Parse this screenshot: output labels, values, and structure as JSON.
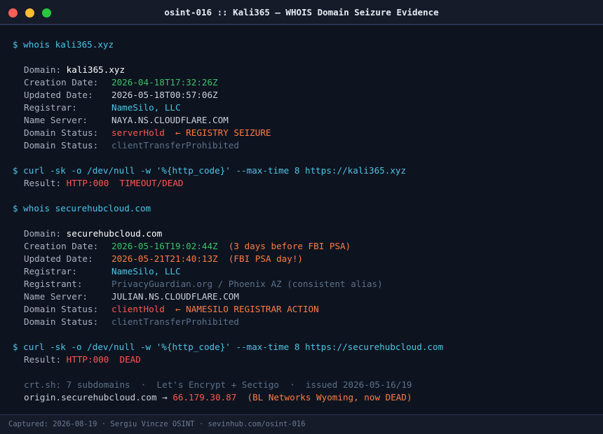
{
  "window": {
    "title": "osint-016 :: Kali365 — WHOIS Domain Seizure Evidence"
  },
  "block1": {
    "cmd": "$ whois kali365.xyz",
    "domain_label": "Domain:",
    "domain_value": "kali365.xyz",
    "creation_label": "Creation Date:",
    "creation_value": "2026-04-18T17:32:26Z",
    "updated_label": "Updated Date:",
    "updated_value": "2026-05-18T00:57:06Z",
    "registrar_label": "Registrar:",
    "registrar_value": "NameSilo, LLC",
    "ns_label": "Name Server:",
    "ns_value": "NAYA.NS.CLOUDFLARE.COM",
    "status1_label": "Domain Status:",
    "status1_value": "serverHold",
    "status1_note": "← REGISTRY SEIZURE",
    "status2_label": "Domain Status:",
    "status2_value": "clientTransferProhibited"
  },
  "block2": {
    "cmd": "$ curl -sk -o /dev/null -w '%{http_code}' --max-time 8 https://kali365.xyz",
    "result_label": "Result:",
    "result_code": "HTTP:000",
    "result_note": "TIMEOUT/DEAD"
  },
  "block3": {
    "cmd": "$ whois securehubcloud.com",
    "domain_label": "Domain:",
    "domain_value": "securehubcloud.com",
    "creation_label": "Creation Date:",
    "creation_value": "2026-05-16T19:02:44Z",
    "creation_note": "(3 days before FBI PSA)",
    "updated_label": "Updated Date:",
    "updated_value": "2026-05-21T21:40:13Z",
    "updated_note": "(FBI PSA day!)",
    "registrar_label": "Registrar:",
    "registrar_value": "NameSilo, LLC",
    "registrant_label": "Registrant:",
    "registrant_value": "PrivacyGuardian.org / Phoenix AZ (consistent alias)",
    "ns_label": "Name Server:",
    "ns_value": "JULIAN.NS.CLOUDFLARE.COM",
    "status1_label": "Domain Status:",
    "status1_value": "clientHold",
    "status1_note": "← NAMESILO REGISTRAR ACTION",
    "status2_label": "Domain Status:",
    "status2_value": "clientTransferProhibited"
  },
  "block4": {
    "cmd": "$ curl -sk -o /dev/null -w '%{http_code}' --max-time 8 https://securehubcloud.com",
    "result_label": "Result:",
    "result_code": "HTTP:000",
    "result_note": "DEAD"
  },
  "block5": {
    "crt_line": "crt.sh: 7 subdomains  ·  Let's Encrypt + Sectigo  ·  issued 2026-05-16/19",
    "origin_host": "origin.securehubcloud.com →",
    "origin_ip": "66.179.30.87",
    "origin_note": "(BL Networks Wyoming, now DEAD)"
  },
  "footer": {
    "text": "Captured: 2026-08-19 · Sergiu Vincze OSINT · sevinhub.com/osint-016"
  },
  "colors": {
    "background": "#0d1420",
    "command": "#4fc3e6",
    "date_green": "#3fbf6a",
    "alert_red": "#ff5555",
    "alert_orange": "#ff7b45",
    "dim": "#5d7088"
  }
}
